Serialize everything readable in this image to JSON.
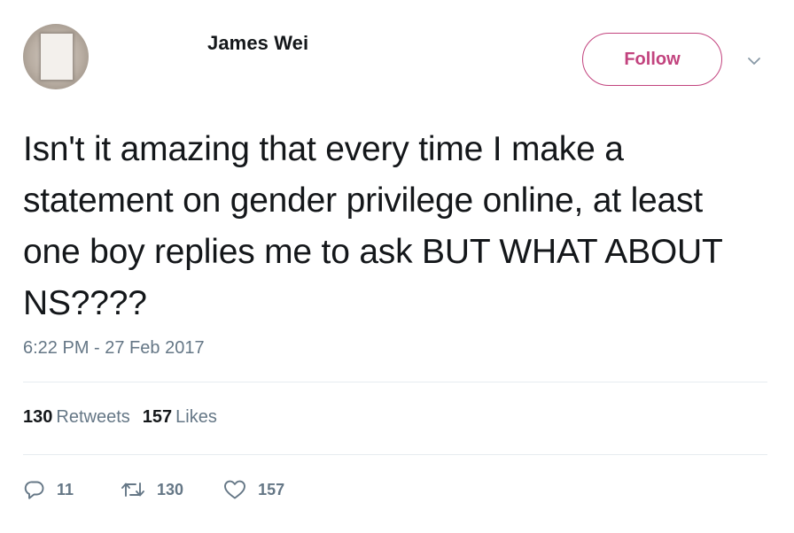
{
  "user": {
    "name": "James Wei"
  },
  "follow_button": {
    "label": "Follow"
  },
  "tweet": {
    "lines": [
      "Isn't it amazing that every time I make a",
      "statement on gender privilege online, at least",
      "one boy replies me to ask BUT WHAT ABOUT",
      "NS????"
    ],
    "timestamp": "6:22 PM - 27 Feb 2017"
  },
  "stats": {
    "retweets_count": "130",
    "retweets_label": "Retweets",
    "likes_count": "157",
    "likes_label": "Likes"
  },
  "actions": {
    "reply_count": "11",
    "retweet_count": "130",
    "like_count": "157"
  },
  "icons": {
    "chevron": "chevron-down-icon",
    "reply": "reply-icon",
    "retweet": "retweet-icon",
    "like": "heart-icon"
  },
  "colors": {
    "accent": "#c2437e",
    "text": "#14171a",
    "muted": "#657786",
    "divider": "#e6ecf0"
  }
}
